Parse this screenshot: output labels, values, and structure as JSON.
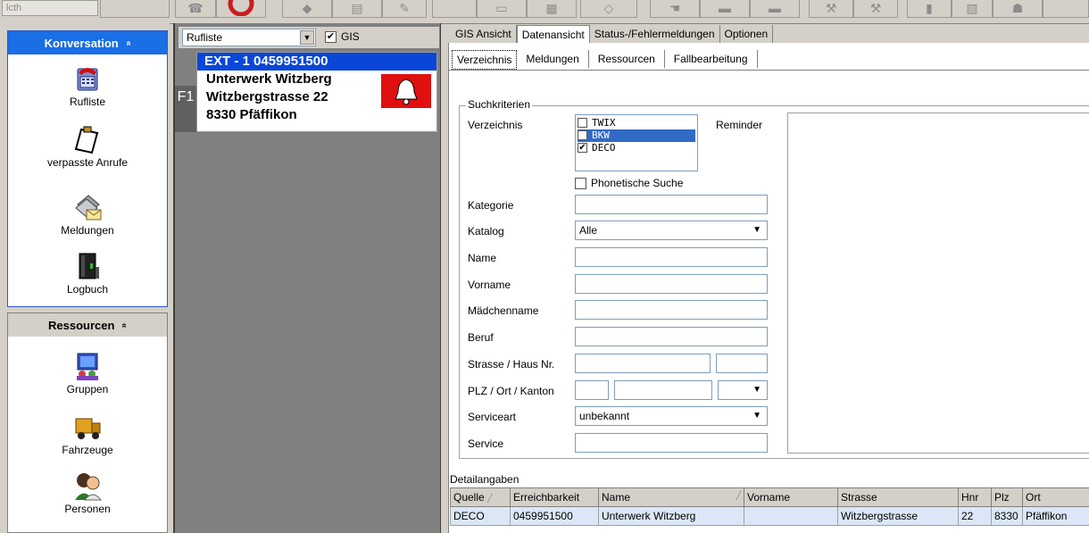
{
  "toolbar": {
    "field_text": "lcth"
  },
  "nav": {
    "groups": [
      {
        "title": "Konversation",
        "items": [
          "Rufliste",
          "verpasste Anrufe",
          "Meldungen",
          "Logbuch"
        ]
      },
      {
        "title": "Ressourcen",
        "items": [
          "Gruppen",
          "Fahrzeuge",
          "Personen"
        ]
      }
    ],
    "collapse_glyph": "«"
  },
  "calls": {
    "list_select": "Rufliste",
    "gis_checkbox_label": "GIS",
    "gis_checked": true,
    "fkey": "F1",
    "card": {
      "header": "EXT - 1 0459951500",
      "line1": "Unterwerk Witzberg",
      "line2": "Witzbergstrasse 22",
      "line3": "8330 Pfäffikon"
    }
  },
  "main_tabs": [
    "GIS Ansicht",
    "Datenansicht",
    "Status-/Fehlermeldungen",
    "Optionen"
  ],
  "main_tabs_active": "Datenansicht",
  "sub_tabs": [
    "Verzeichnis",
    "Meldungen",
    "Ressourcen",
    "Fallbearbeitung"
  ],
  "sub_tabs_active": "Verzeichnis",
  "search": {
    "group_title": "Suchkriterien",
    "verzeichnis_label": "Verzeichnis",
    "verzeichnis_options": [
      {
        "label": "TWIX",
        "checked": false,
        "selected": false
      },
      {
        "label": "BKW",
        "checked": false,
        "selected": true
      },
      {
        "label": "DECO",
        "checked": true,
        "selected": false
      }
    ],
    "reminder_label": "Reminder",
    "phonetic_label": "Phonetische Suche",
    "kategorie_label": "Kategorie",
    "katalog_label": "Katalog",
    "katalog_value": "Alle",
    "name_label": "Name",
    "vorname_label": "Vorname",
    "maedchenname_label": "Mädchenname",
    "beruf_label": "Beruf",
    "strasse_label": "Strasse / Haus Nr.",
    "plz_label": "PLZ / Ort / Kanton",
    "serviceart_label": "Serviceart",
    "serviceart_value": "unbekannt",
    "service_label": "Service"
  },
  "details": {
    "title": "Detailangaben",
    "columns": [
      "Quelle",
      "Erreichbarkeit",
      "Name",
      "Vorname",
      "Strasse",
      "Hnr",
      "Plz",
      "Ort"
    ],
    "rows": [
      [
        "DECO",
        "0459951500",
        "Unterwerk Witzberg",
        "",
        "Witzbergstrasse",
        "22",
        "8330",
        "Pfäffikon"
      ]
    ]
  }
}
